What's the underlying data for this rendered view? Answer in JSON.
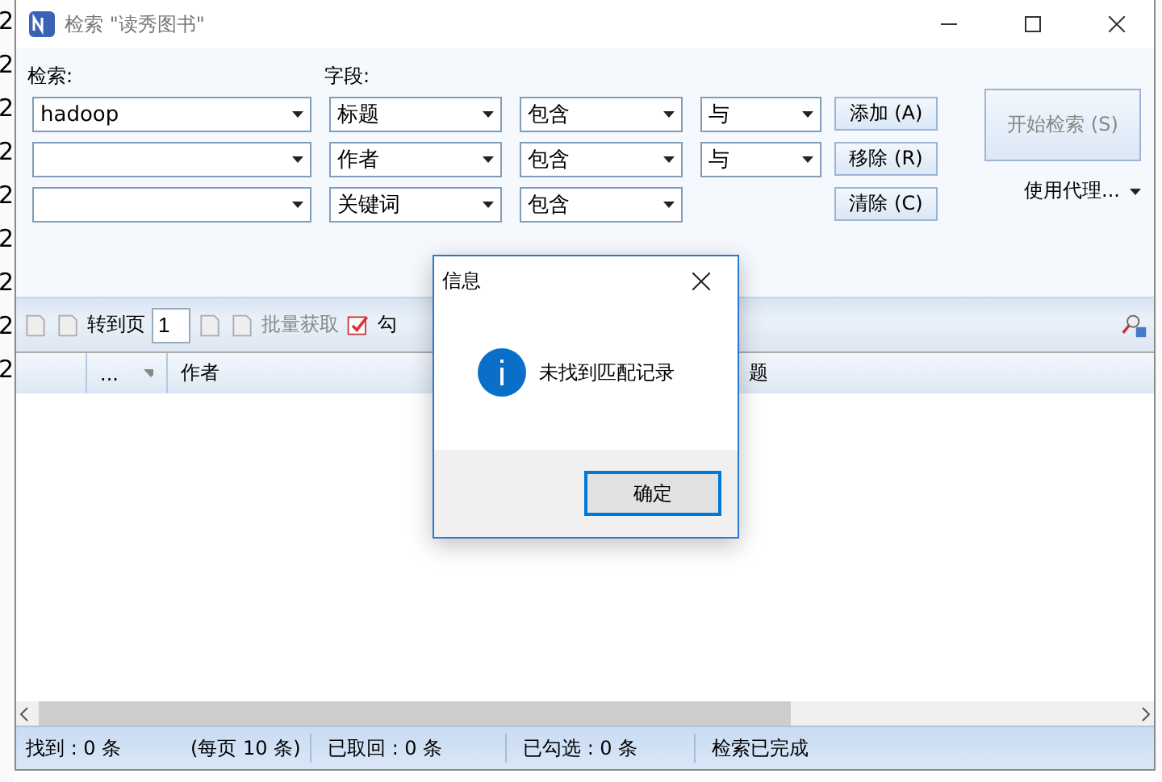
{
  "window": {
    "title": "检索 \"读秀图书\""
  },
  "background": {
    "left_fragments": [
      "2",
      "2",
      "2",
      "2",
      "2",
      "2",
      "2",
      "2",
      "2"
    ]
  },
  "search": {
    "term_label": "检索:",
    "field_label": "字段:",
    "rows": [
      {
        "term": "hadoop",
        "field": "标题",
        "match": "包含",
        "logic": "与",
        "button": "添加 (A)"
      },
      {
        "term": "",
        "field": "作者",
        "match": "包含",
        "logic": "与",
        "button": "移除 (R)"
      },
      {
        "term": "",
        "field": "关键词",
        "match": "包含",
        "button": "清除 (C)"
      }
    ],
    "start_button": {
      "label": "开始检索 (S)",
      "disabled": true
    },
    "proxy": "使用代理..."
  },
  "toolbar": {
    "page_label": "转到页",
    "page": "1",
    "batch": "批量获取",
    "check": "勾"
  },
  "table": {
    "columns": [
      "...",
      "作者",
      "题"
    ]
  },
  "status_bar": [
    "找到 : 0 条",
    "(每页 10 条)",
    "已取回 : 0 条",
    "已勾选 : 0 条",
    "检索已完成"
  ],
  "dialog": {
    "title": "信息",
    "message": "未找到匹配记录",
    "button": "确定"
  }
}
